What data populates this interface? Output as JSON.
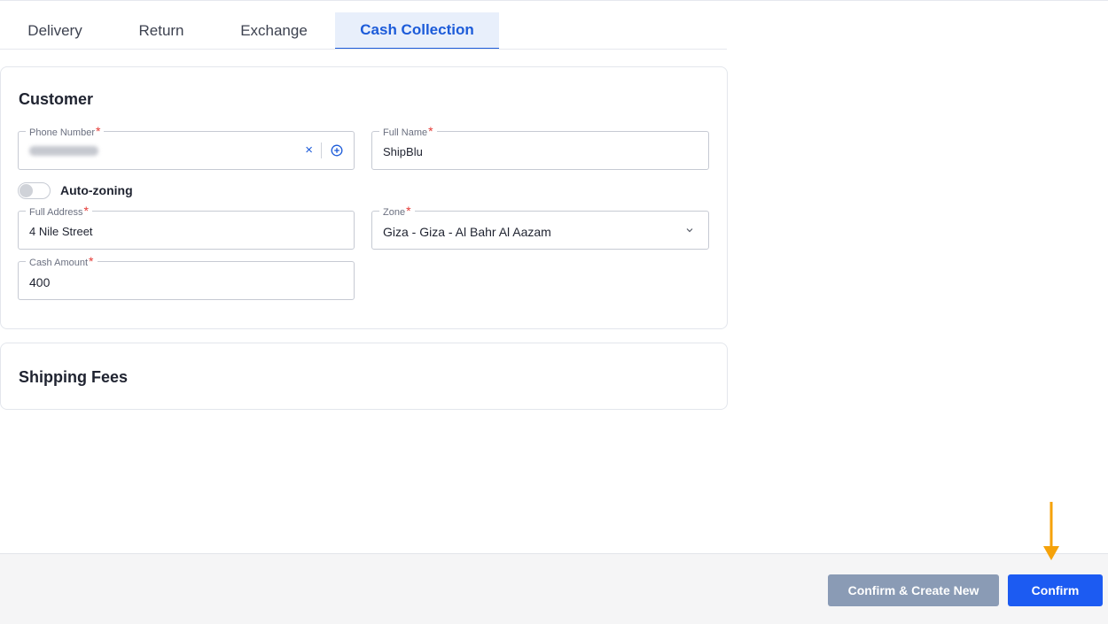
{
  "tabs": [
    {
      "label": "Delivery",
      "active": false
    },
    {
      "label": "Return",
      "active": false
    },
    {
      "label": "Exchange",
      "active": false
    },
    {
      "label": "Cash Collection",
      "active": true
    }
  ],
  "customer": {
    "title": "Customer",
    "phone": {
      "label": "Phone Number",
      "value": ""
    },
    "full_name": {
      "label": "Full Name",
      "value": "ShipBlu"
    },
    "auto_zoning": {
      "label": "Auto-zoning",
      "enabled": false
    },
    "full_address": {
      "label": "Full Address",
      "value": "4 Nile Street"
    },
    "zone": {
      "label": "Zone",
      "value": "Giza - Giza - Al Bahr Al Aazam"
    },
    "cash_amount": {
      "label": "Cash Amount",
      "value": "400"
    },
    "required_mark": "*",
    "clear_glyph": "×"
  },
  "shipping_fees": {
    "title": "Shipping Fees"
  },
  "footer": {
    "confirm_create_new": "Confirm & Create New",
    "confirm": "Confirm"
  },
  "colors": {
    "primary": "#1c5bf2",
    "secondary_button": "#8a9bb5",
    "required": "#e53935",
    "arrow": "#f5a20a"
  }
}
